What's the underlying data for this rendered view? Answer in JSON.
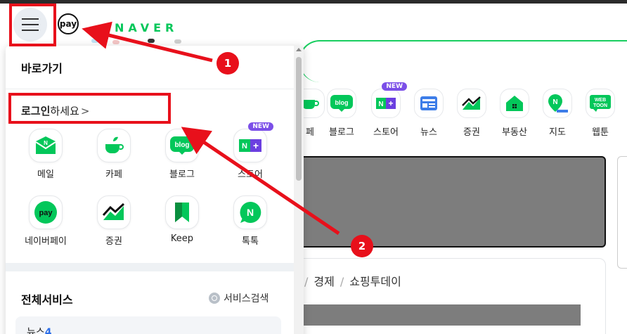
{
  "header": {
    "menu_icon": "hamburger-menu-icon",
    "pay_label": "pay",
    "logo_text": "NAVER"
  },
  "background": {
    "shortcuts": [
      {
        "label": "페",
        "icon": "cafe-icon"
      },
      {
        "label": "블로그",
        "icon": "blog-icon",
        "icon_text": "blog"
      },
      {
        "label": "스토어",
        "icon": "store-icon",
        "icon_text": "N+",
        "badge": "NEW"
      },
      {
        "label": "뉴스",
        "icon": "news-icon"
      },
      {
        "label": "증권",
        "icon": "stock-icon"
      },
      {
        "label": "부동산",
        "icon": "real-estate-icon"
      },
      {
        "label": "지도",
        "icon": "map-icon"
      },
      {
        "label": "웹툰",
        "icon": "webtoon-icon",
        "icon_text": "WEB TOON"
      }
    ],
    "news_tabs": [
      "경제",
      "쇼핑투데이"
    ]
  },
  "panel": {
    "title": "바로가기",
    "login_strong": "로그인",
    "login_rest": "하세요",
    "login_arrow": ">",
    "shortcuts": [
      {
        "label": "메일",
        "icon": "mail-icon"
      },
      {
        "label": "카페",
        "icon": "cafe-icon"
      },
      {
        "label": "블로그",
        "icon": "blog-icon",
        "icon_text": "blog"
      },
      {
        "label": "스토어",
        "icon": "store-icon",
        "icon_text": "N+",
        "badge": "NEW"
      },
      {
        "label": "네이버페이",
        "icon": "naver-pay-icon",
        "icon_text": "pay"
      },
      {
        "label": "증권",
        "icon": "stock-icon"
      },
      {
        "label": "Keep",
        "icon": "keep-bookmark-icon"
      },
      {
        "label": "톡톡",
        "icon": "talktalk-icon",
        "icon_text": "N"
      }
    ],
    "services_title": "전체서비스",
    "service_search_label": "서비스검색",
    "news_item": {
      "label": "뉴스",
      "count": "4"
    }
  },
  "annotations": {
    "marker_1": "1",
    "marker_2": "2",
    "color": "#e8101b"
  },
  "colors": {
    "naver_green": "#03c75a",
    "new_badge": "#7b4fe8"
  }
}
